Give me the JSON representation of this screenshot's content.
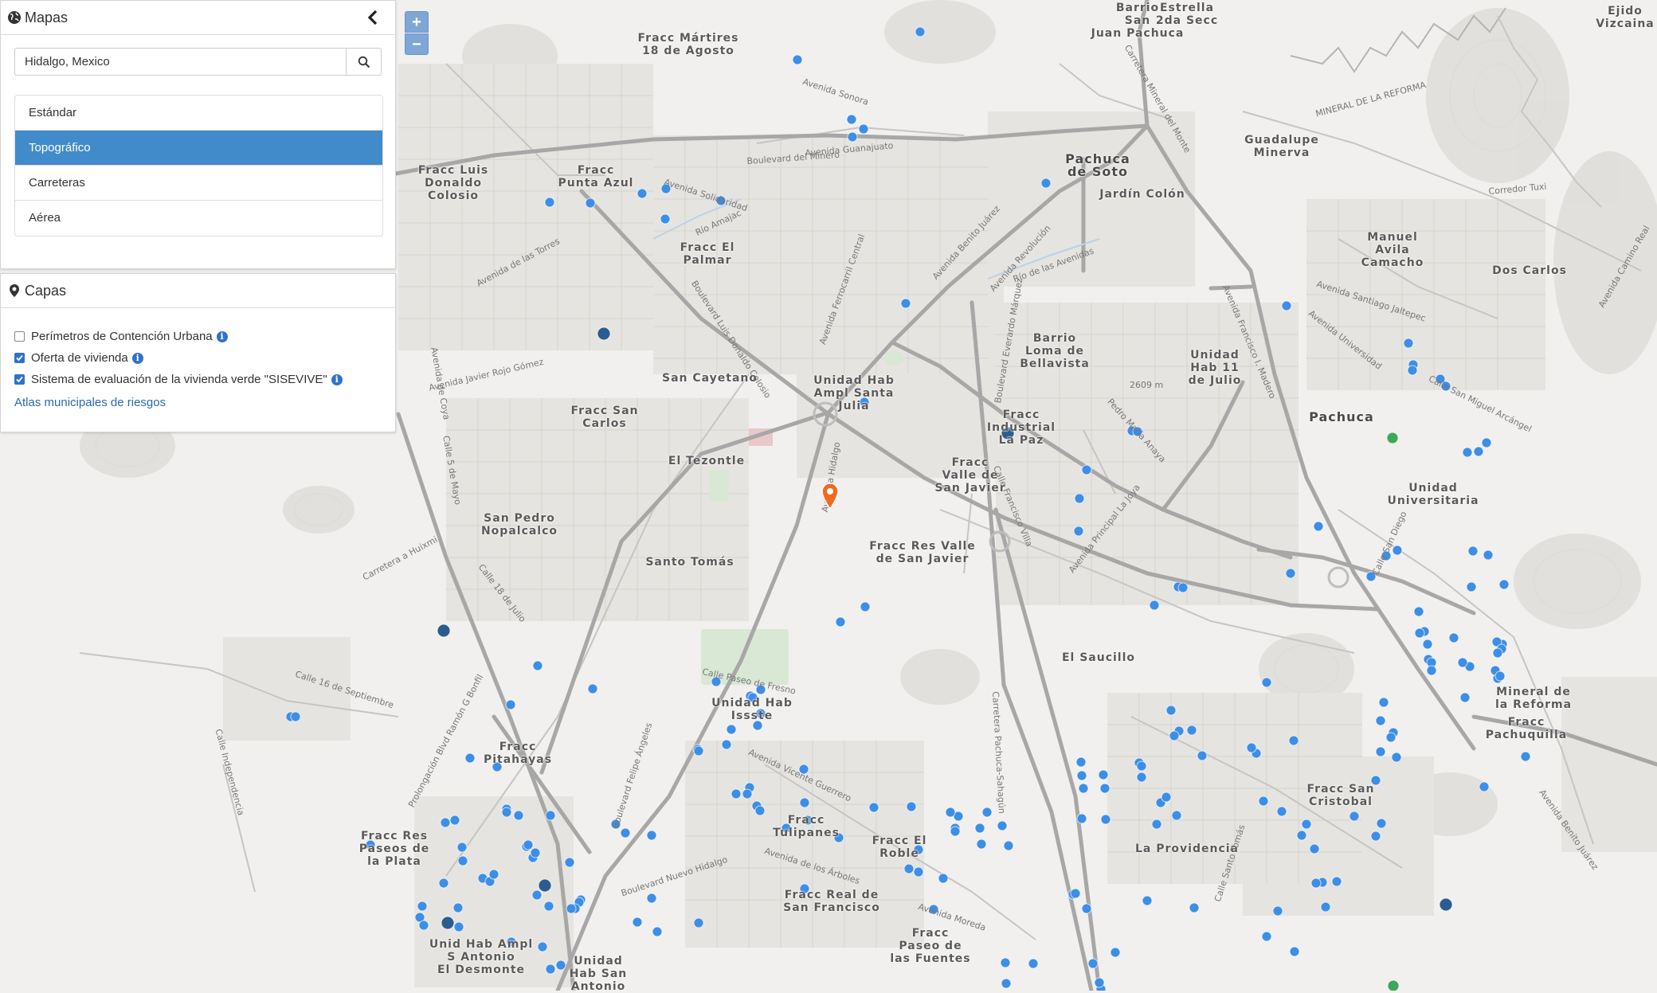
{
  "panel_maps": {
    "title": "Mapas",
    "search_value": "Hidalgo, Mexico",
    "base_layers": [
      "Estándar",
      "Topográfico",
      "Carreteras",
      "Aérea"
    ],
    "active_layer": "Topográfico"
  },
  "panel_layers": {
    "title": "Capas",
    "layers": [
      {
        "label": "Perímetros de Contención Urbana",
        "checked": false
      },
      {
        "label": "Oferta de vivienda",
        "checked": true
      },
      {
        "label": "Sistema de evaluación de la vivienda verde \"SISEVIVE\"",
        "checked": true
      }
    ],
    "link": "Atlas municipales de riesgos"
  },
  "zoom": {
    "in": "+",
    "out": "−"
  },
  "colors": {
    "active": "#428bca",
    "point": "#3d8ee6",
    "point_dark": "#2c5c8f",
    "point_green": "#3fa757",
    "marker": "#f26a21"
  },
  "places": [
    "Barrio\nSan\nJuan Pachuca",
    "Estrella\n2da Secc",
    "Ejido\nVizcaina",
    "Fracc Mártires\n18 de Agosto",
    "Fracc Luis\nDonaldo\nColosio",
    "Fracc\nPunta Azul",
    "Pachuca\nde Soto",
    "Jardín Colón",
    "Guadalupe\nMinerva",
    "Fracc El\nPalmar",
    "Manuel\nAvila\nCamacho",
    "Dos Carlos",
    "Barrio\nLoma de\nBellavista",
    "Unidad\nHab 11\nde Julio",
    "San Cayetano",
    "Unidad Hab\nAmpl Santa\nJulia",
    "Fracc San\nCarlos",
    "Pachuca",
    "Fracc\nIndustrial\nLa Paz",
    "El Tezontle",
    "Fracc\nValle de\nSan Javier",
    "Unidad\nUniversitaria",
    "San Pedro\nNopalcalco",
    "Santo Tomás",
    "Fracc Res Valle\nde San Javier",
    "El Saucillo",
    "Unidad Hab\nIssste",
    "Mineral de\nla Reforma",
    "Fracc\nPitahayas",
    "Fracc\nPachuquilla",
    "Fracc San\nCristobal",
    "Fracc\nTulipanes",
    "Fracc Res\nPaseos de\nla Plata",
    "Fracc El\nRoble",
    "La Providencia",
    "Fracc Real de\nSan Francisco",
    "Unid Hab Ampl\nS Antonio\nEl Desmonte",
    "Fracc\nPaseo de\nlas Fuentes",
    "Unidad\nHab San\nAntonio"
  ],
  "streets": [
    "Avenida Sonora",
    "Avenida Guanajuato",
    "Boulevard del Minero",
    "Avenida Solidaridad",
    "Río Amajac",
    "Avenida de las Torres",
    "Avenida Javier Rojo Gómez",
    "Boulevard Luis Donaldo Colosio",
    "Avenida Ferrocarril Central",
    "Avenida Benito Juárez",
    "Avenida Revolución",
    "Río de las Avenidas",
    "Boulevard Everardo Márquez",
    "Avenida Francisco I. Madero",
    "MINERAL DE LA REFORMA",
    "Avenida Santiago Jaltepec",
    "Avenida Universidad",
    "Calle San Miguel Arcángel",
    "Avenida de Coya",
    "Calle 5 de Mayo",
    "Calle 18 de Julio",
    "Carretera a Huixmi",
    "Calle 16 de Septiembre",
    "Prolongación Blvd Ramón G Bonfil",
    "Boulevard Felipe Ángeles",
    "Avenida Vicente Guerrero",
    "Boulevard Nuevo Hidalgo",
    "Avenida Moreda",
    "Carretera Pachuca-Sahagún",
    "Avenida Principal La Joya",
    "Calle Francisco Villa",
    "Calle Paseo de Fresno",
    "Avenida de los Árboles",
    "Avenida Hidalgo",
    "Avenida Benito Juárez",
    "Calle Santo Tomás",
    "Calle Independencia",
    "Avenida Camino Real",
    "Carretera Mineral del Monte",
    "Corredor Tuxi",
    "Pedro María Anaya",
    "Calle San Diego",
    "2609 m"
  ]
}
